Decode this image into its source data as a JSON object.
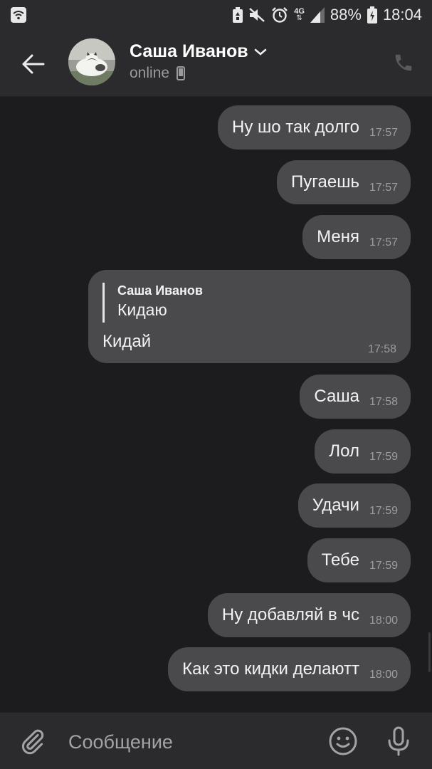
{
  "status_bar": {
    "network_type": "4G",
    "battery": "88%",
    "time": "18:04",
    "icons": [
      "wifi-icon",
      "battery-saver-icon",
      "mute-icon",
      "alarm-icon",
      "network-4g-icon",
      "signal-icon",
      "battery-icon"
    ]
  },
  "header": {
    "contact_name": "Саша Иванов",
    "status": "online",
    "icons": [
      "back-arrow-icon",
      "chevron-down-icon",
      "mobile-device-icon",
      "phone-icon"
    ]
  },
  "messages": [
    {
      "text": "Ну шо так долго",
      "time": "17:57"
    },
    {
      "text": "Пугаешь",
      "time": "17:57"
    },
    {
      "text": "Меня",
      "time": "17:57"
    },
    {
      "reply_author": "Саша Иванов",
      "reply_text": "Кидаю",
      "text": "Кидай",
      "time": "17:58"
    },
    {
      "text": "Саша",
      "time": "17:58"
    },
    {
      "text": "Лол",
      "time": "17:59"
    },
    {
      "text": "Удачи",
      "time": "17:59"
    },
    {
      "text": "Тебе",
      "time": "17:59"
    },
    {
      "text": "Ну добавляй в чс",
      "time": "18:00"
    },
    {
      "text": "Как это кидки делаютт",
      "time": "18:00"
    }
  ],
  "composer": {
    "placeholder": "Сообщение",
    "icons": [
      "paperclip-icon",
      "emoji-icon",
      "microphone-icon"
    ]
  },
  "colors": {
    "background": "#1c1c1e",
    "bar": "#2b2b2d",
    "bubble": "#4a4a4c",
    "text": "#f2f2f2",
    "muted": "#9d9da1"
  }
}
